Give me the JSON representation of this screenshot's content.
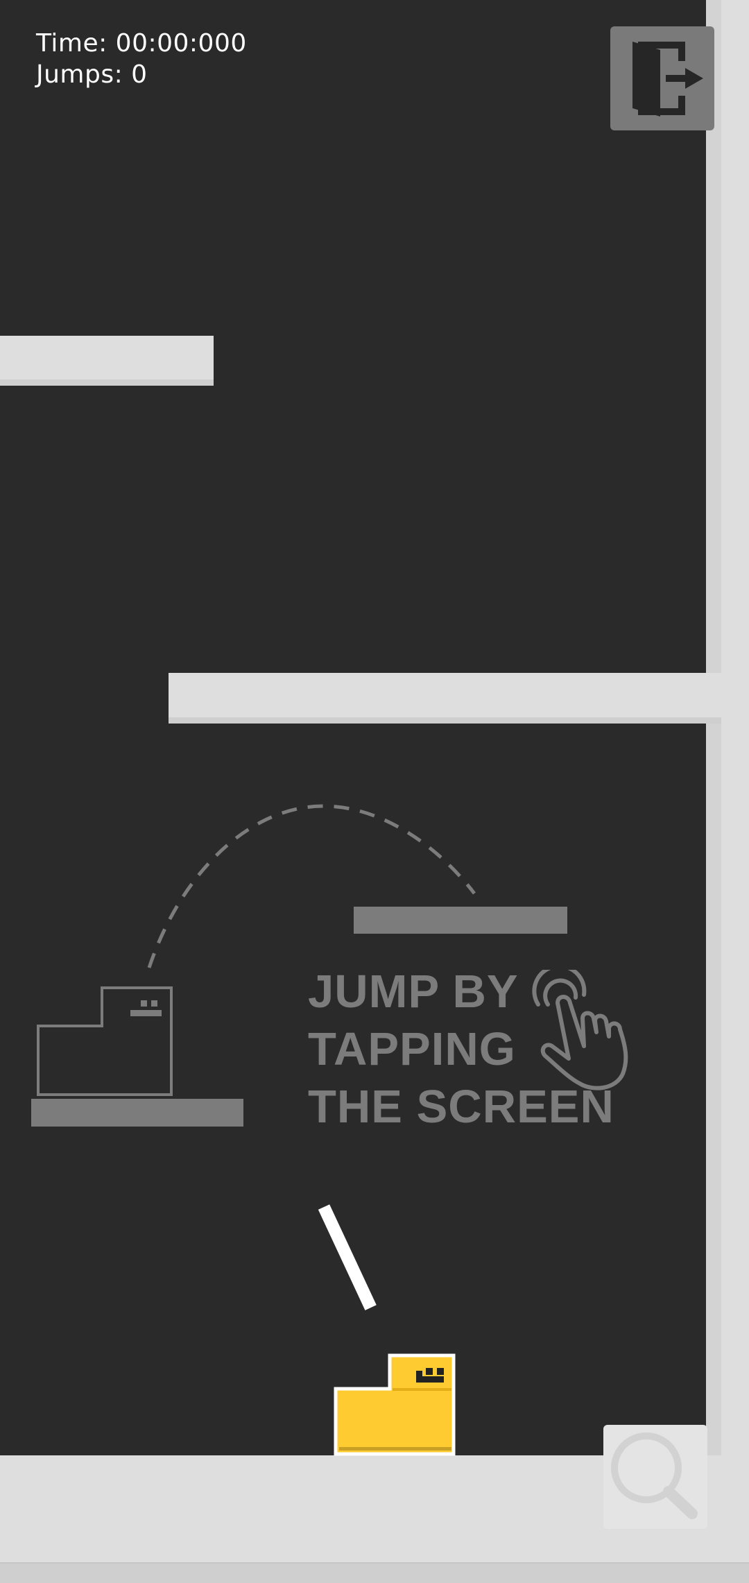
{
  "hud": {
    "time_label": "Time: 00:00:000",
    "jumps_label": "Jumps: 0"
  },
  "buttons": {
    "exit_icon": "exit-door-icon",
    "zoom_icon": "magnifier-icon"
  },
  "tutorial": {
    "lines": [
      "JUMP BY",
      "TAPPING",
      "THE SCREEN"
    ],
    "hand_icon": "tap-hand-icon"
  },
  "colors": {
    "background": "#2a2a2a",
    "platform": "#dedede",
    "player": "#fecb31",
    "hint": "#7c7c7c",
    "button": "#7a7a7a"
  }
}
